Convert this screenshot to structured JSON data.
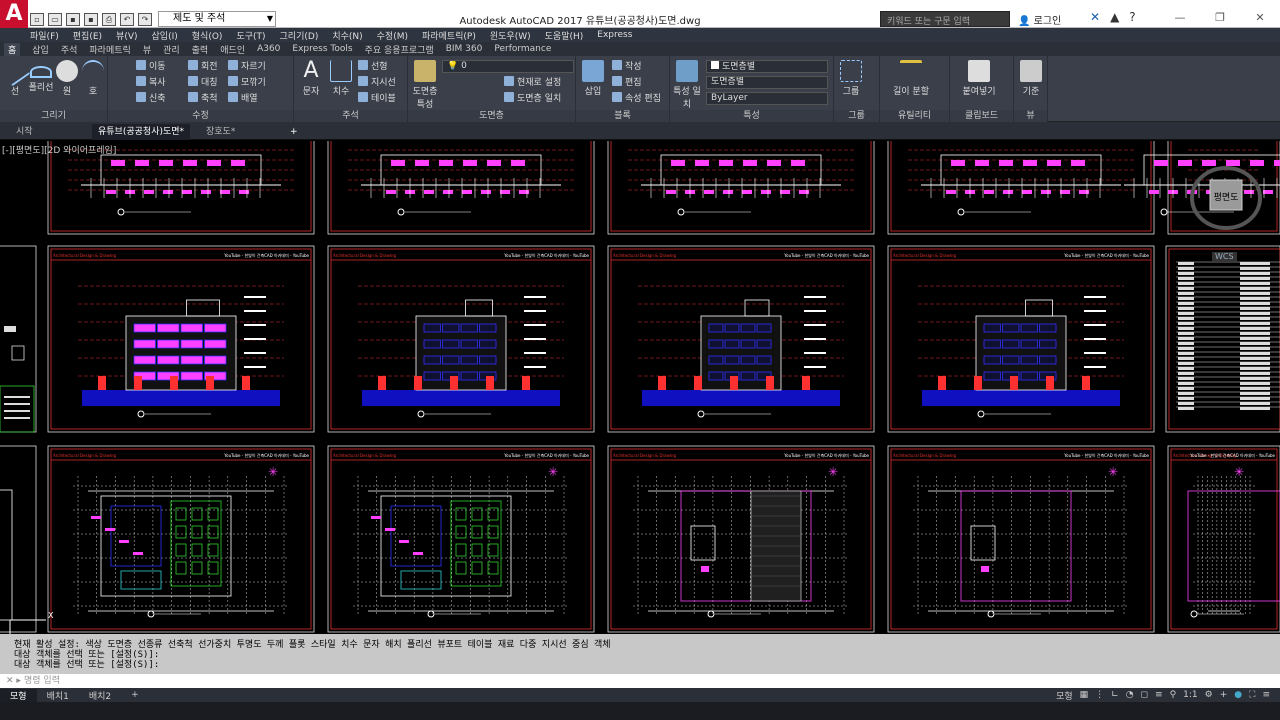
{
  "app": {
    "logo": "A",
    "title": "Autodesk AutoCAD 2017    유튜브(공공청사)도면.dwg",
    "workspace": "제도 및 주석",
    "search_placeholder": "키워드 또는 구문 입력",
    "user": "로그인"
  },
  "menu": [
    "파일(F)",
    "편집(E)",
    "뷰(V)",
    "삽입(I)",
    "형식(O)",
    "도구(T)",
    "그리기(D)",
    "치수(N)",
    "수정(M)",
    "파라메트릭(P)",
    "윈도우(W)",
    "도움말(H)",
    "Express"
  ],
  "ribbon_tabs": [
    "홈",
    "삽입",
    "주석",
    "파라메트릭",
    "뷰",
    "관리",
    "출력",
    "애드인",
    "A360",
    "Express Tools",
    "주요 응용프로그램",
    "BIM 360",
    "Performance"
  ],
  "ribbon": {
    "draw": {
      "label": "그리기",
      "items": [
        "선",
        "폴리선",
        "원",
        "호"
      ]
    },
    "modify": {
      "label": "수정",
      "items": [
        "이동",
        "회전",
        "자르기",
        "복사",
        "대칭",
        "모깎기",
        "신축",
        "축척",
        "배열"
      ]
    },
    "annotation": {
      "label": "주석",
      "items": [
        "문자",
        "치수",
        "선형",
        "지시선",
        "테이블"
      ]
    },
    "layers": {
      "label": "도면층",
      "layer_value": "0",
      "items": [
        "도면층 특성",
        "현재로 설정",
        "도면층 일치"
      ]
    },
    "block": {
      "label": "블록",
      "items": [
        "삽입",
        "작성",
        "편집",
        "속성 편집"
      ]
    },
    "properties": {
      "label": "특성",
      "items": [
        "특성 일치",
        "도면층별",
        "도면층별",
        "ByLayer"
      ]
    },
    "groups": {
      "label": "그룹",
      "items": [
        "그룹"
      ]
    },
    "utilities": {
      "label": "유틸리티",
      "items": [
        "길이 분할"
      ]
    },
    "clipboard": {
      "label": "클립보드",
      "items": [
        "붙여넣기"
      ]
    },
    "view": {
      "label": "뷰",
      "items": [
        "기준"
      ]
    }
  },
  "doc_tabs": [
    "시작",
    "유튜브(공공청사)도면*",
    "장호도*"
  ],
  "viewport_label": "[-][평면도][2D 와이어프레임]",
  "viewcube": {
    "label": "평면도",
    "wcs": "WCS"
  },
  "command_history": [
    "현재 활성 설정:  색상 도면층 선종류 선축척 선가중치 투명도 두께 플롯 스타일 치수 문자 해치 폴리선 뷰포트 테이블 재료 다중 지시선 중심 객체",
    "대상 객체를 선택 또는 [설정(S)]:",
    "대상 객체를 선택 또는 [설정(S)]:"
  ],
  "command_placeholder": "명령 입력",
  "layout_tabs": [
    "모형",
    "배치1",
    "배치2"
  ],
  "status": {
    "model": "모형",
    "scale": "1:1"
  },
  "sheet_header": "Architectural Design & Drawing",
  "sheet_header_right": "YouTube - 한빛이 건축CAD 아카데미 - YouTube",
  "colors": {
    "frame": "#e03030",
    "dim": "#ffffff",
    "wall": "#ff40ff",
    "ground": "#1010c0",
    "window": "#3030ff",
    "tree": "#ff3030",
    "green": "#30d030",
    "cyan": "#30d0d0",
    "yellow": "#e0e030"
  }
}
